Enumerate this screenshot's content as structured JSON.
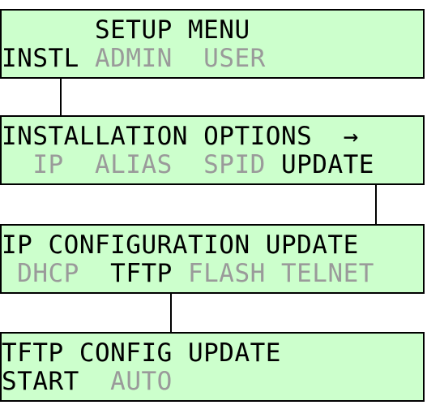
{
  "colors": {
    "panel_bg": "#ccffcc",
    "border": "#000000",
    "active_text": "#000000",
    "inactive_text": "#9a9a9a"
  },
  "panels": {
    "setup": {
      "title": "      SETUP MENU",
      "options": {
        "instl": "INSTL",
        "admin": "ADMIN",
        "user": "USER"
      }
    },
    "installation": {
      "title": "INSTALLATION OPTIONS  ",
      "arrow": "→",
      "options": {
        "ip": "IP",
        "alias": "ALIAS",
        "spid": "SPID",
        "update": "UPDATE"
      }
    },
    "ip_config": {
      "title": "IP CONFIGURATION UPDATE",
      "options": {
        "dhcp": "DHCP",
        "tftp": "TFTP",
        "flash": "FLASH",
        "telnet": "TELNET"
      }
    },
    "tftp_config": {
      "title": "TFTP CONFIG UPDATE",
      "options": {
        "start": "START",
        "auto": "AUTO"
      }
    }
  }
}
